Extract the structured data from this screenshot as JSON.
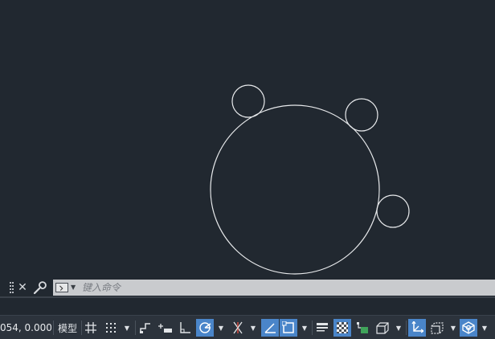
{
  "drawing": {
    "shapes": [
      {
        "type": "circle",
        "role": "large-circle"
      },
      {
        "type": "circle",
        "role": "small-circle-top-left"
      },
      {
        "type": "circle",
        "role": "small-circle-top-right"
      },
      {
        "type": "circle",
        "role": "small-circle-right"
      }
    ],
    "stroke_color": "#e8eaec",
    "background_color": "#212830"
  },
  "command_line": {
    "placeholder": "键入命令",
    "close_icon": "close-icon",
    "customize_icon": "wrench-icon",
    "prompt_icon": "command-prompt-icon"
  },
  "status_bar": {
    "coordinates": "054, 0.0000",
    "model_label": "模型",
    "buttons": [
      {
        "name": "grid-icon",
        "active": false
      },
      {
        "name": "snap-mode-icon",
        "active": false
      },
      {
        "name": "infer-constraints-icon",
        "active": false
      },
      {
        "name": "dynamic-input-icon",
        "active": false
      },
      {
        "name": "ortho-mode-icon",
        "active": false
      },
      {
        "name": "polar-tracking-icon",
        "active": true
      },
      {
        "name": "isometric-drafting-icon",
        "active": false
      },
      {
        "name": "object-snap-tracking-icon",
        "active": true
      },
      {
        "name": "object-snap-icon",
        "active": true
      },
      {
        "name": "lineweight-icon",
        "active": false
      },
      {
        "name": "transparency-icon",
        "active": true
      },
      {
        "name": "selection-cycling-icon",
        "active": false
      },
      {
        "name": "3d-object-snap-icon",
        "active": false
      },
      {
        "name": "dynamic-ucs-icon",
        "active": true
      },
      {
        "name": "selection-filter-icon",
        "active": false
      },
      {
        "name": "gizmo-icon",
        "active": true
      }
    ],
    "accent_color": "#4a85c9"
  }
}
